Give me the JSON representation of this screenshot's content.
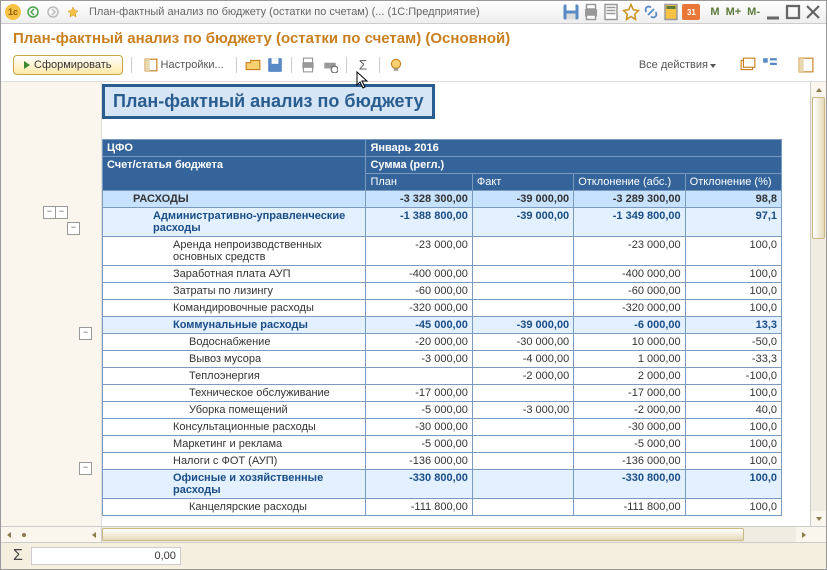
{
  "window": {
    "title": "План-фактный анализ по бюджету (остатки по счетам) (... (1С:Предприятие)"
  },
  "header": {
    "title": "План-фактный анализ по бюджету (остатки по счетам) (Основной)"
  },
  "toolbar": {
    "generate": "Сформировать",
    "settings": "Настройки...",
    "allActions": "Все действия"
  },
  "mbuttons": {
    "m": "M",
    "mp": "M+",
    "mm": "M-"
  },
  "report": {
    "title": "План-фактный анализ по бюджету",
    "h_cfo": "ЦФО",
    "h_account": "Счет/статья бюджета",
    "h_period": "Январь 2016",
    "h_sum": "Сумма (регл.)",
    "h_plan": "План",
    "h_fact": "Факт",
    "h_dev_abs": "Отклонение (абс.)",
    "h_dev_pct": "Отклонение (%)",
    "rows": [
      {
        "lvl": 1,
        "cls": "bold-cyan",
        "name": "РАСХОДЫ",
        "plan": "-3 328 300,00",
        "fact": "-39 000,00",
        "abs": "-3 289 300,00",
        "pct": "98,8"
      },
      {
        "lvl": 2,
        "cls": "bold-blue",
        "name": "Административно-управленческие расходы",
        "plan": "-1 388 800,00",
        "fact": "-39 000,00",
        "abs": "-1 349 800,00",
        "pct": "97,1"
      },
      {
        "lvl": 3,
        "cls": "plain",
        "name": "Аренда непроизводственных основных средств",
        "plan": "-23 000,00",
        "fact": "",
        "abs": "-23 000,00",
        "pct": "100,0"
      },
      {
        "lvl": 3,
        "cls": "plain",
        "name": "Заработная плата АУП",
        "plan": "-400 000,00",
        "fact": "",
        "abs": "-400 000,00",
        "pct": "100,0"
      },
      {
        "lvl": 3,
        "cls": "plain",
        "name": "Затраты по лизингу",
        "plan": "-60 000,00",
        "fact": "",
        "abs": "-60 000,00",
        "pct": "100,0"
      },
      {
        "lvl": 3,
        "cls": "plain",
        "name": "Командировочные расходы",
        "plan": "-320 000,00",
        "fact": "",
        "abs": "-320 000,00",
        "pct": "100,0"
      },
      {
        "lvl": 3,
        "cls": "bold-blue",
        "name": "Коммунальные расходы",
        "plan": "-45 000,00",
        "fact": "-39 000,00",
        "abs": "-6 000,00",
        "pct": "13,3"
      },
      {
        "lvl": 4,
        "cls": "plain",
        "name": "Водоснабжение",
        "plan": "-20 000,00",
        "fact": "-30 000,00",
        "abs": "10 000,00",
        "pct": "-50,0"
      },
      {
        "lvl": 4,
        "cls": "plain",
        "name": "Вывоз мусора",
        "plan": "-3 000,00",
        "fact": "-4 000,00",
        "abs": "1 000,00",
        "pct": "-33,3"
      },
      {
        "lvl": 4,
        "cls": "plain",
        "name": "Теплоэнергия",
        "plan": "",
        "fact": "-2 000,00",
        "abs": "2 000,00",
        "pct": "-100,0"
      },
      {
        "lvl": 4,
        "cls": "plain",
        "name": "Техническое обслуживание",
        "plan": "-17 000,00",
        "fact": "",
        "abs": "-17 000,00",
        "pct": "100,0"
      },
      {
        "lvl": 4,
        "cls": "plain",
        "name": "Уборка помещений",
        "plan": "-5 000,00",
        "fact": "-3 000,00",
        "abs": "-2 000,00",
        "pct": "40,0"
      },
      {
        "lvl": 3,
        "cls": "plain",
        "name": "Консультационные расходы",
        "plan": "-30 000,00",
        "fact": "",
        "abs": "-30 000,00",
        "pct": "100,0"
      },
      {
        "lvl": 3,
        "cls": "plain",
        "name": "Маркетинг и реклама",
        "plan": "-5 000,00",
        "fact": "",
        "abs": "-5 000,00",
        "pct": "100,0"
      },
      {
        "lvl": 3,
        "cls": "plain",
        "name": "Налоги с ФОТ (АУП)",
        "plan": "-136 000,00",
        "fact": "",
        "abs": "-136 000,00",
        "pct": "100,0"
      },
      {
        "lvl": 3,
        "cls": "bold-blue",
        "name": "Офисные и хозяйственные расходы",
        "plan": "-330 800,00",
        "fact": "",
        "abs": "-330 800,00",
        "pct": "100,0"
      },
      {
        "lvl": 4,
        "cls": "plain",
        "name": "Канцелярские расходы",
        "plan": "-111 800,00",
        "fact": "",
        "abs": "-111 800,00",
        "pct": "100,0"
      }
    ]
  },
  "footer": {
    "sum": "0,00"
  }
}
